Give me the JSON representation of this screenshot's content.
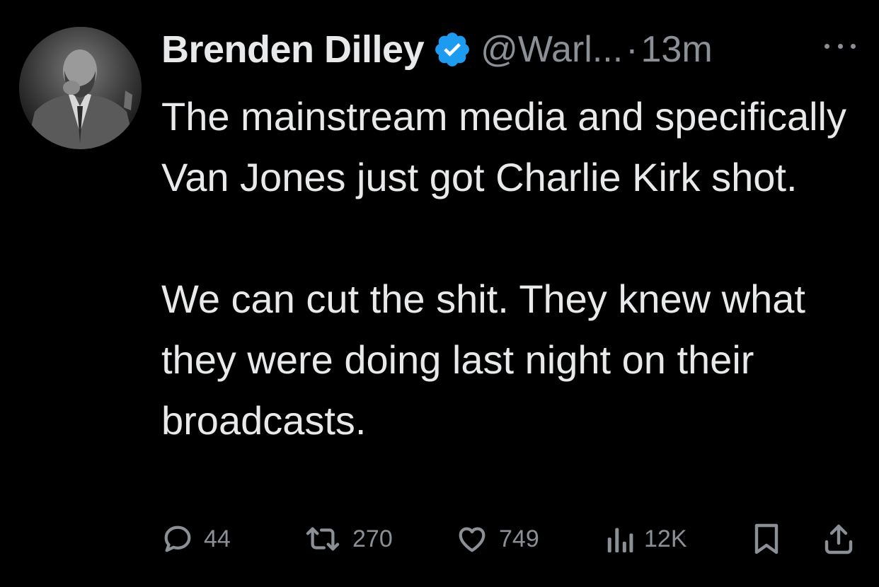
{
  "author": {
    "display_name": "Brenden Dilley",
    "handle": "@Warl...",
    "separator": "·",
    "timestamp": "13m",
    "verified": true
  },
  "tweet": {
    "paragraphs": [
      "The mainstream media and specifically Van Jones just got Charlie Kirk shot.",
      "We can cut the shit. They knew what they were doing last night on their broadcasts."
    ]
  },
  "actions": {
    "reply_count": "44",
    "retweet_count": "270",
    "like_count": "749",
    "views_count": "12K"
  },
  "colors": {
    "background": "#000000",
    "text": "#e7e9ea",
    "muted": "#8b9096",
    "verified_badge": "#1d9bf0"
  },
  "icons": {
    "verified": "verified-badge-icon",
    "more": "more-dots-icon",
    "reply": "reply-bubble-icon",
    "retweet": "retweet-icon",
    "like": "heart-icon",
    "views": "views-bar-chart-icon",
    "bookmark": "bookmark-icon",
    "share": "share-upload-icon"
  }
}
